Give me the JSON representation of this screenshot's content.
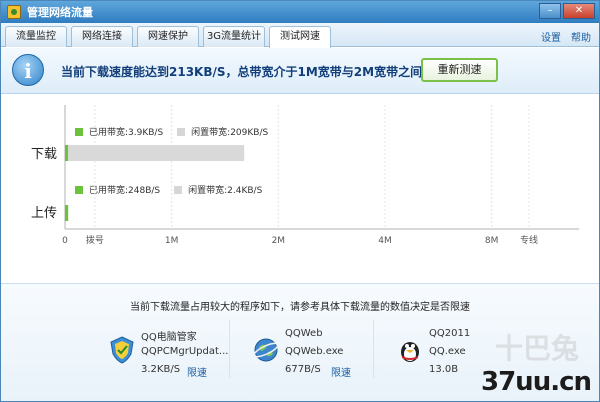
{
  "window": {
    "title": "管理网络流量"
  },
  "tabs": [
    {
      "label": "流量监控"
    },
    {
      "label": "网络连接"
    },
    {
      "label": "网速保护"
    },
    {
      "label": "3G流量统计"
    },
    {
      "label": "测试网速"
    }
  ],
  "toplinks": {
    "settings": "设置",
    "help": "帮助"
  },
  "banner": {
    "message": "当前下载速度能达到213KB/S，总带宽介于1M宽带与2M宽带之间",
    "retest_button": "重新测速"
  },
  "legend": {
    "download": {
      "used": "已用带宽:3.9KB/S",
      "idle": "闲置带宽:209KB/S"
    },
    "upload": {
      "used": "已用带宽:248B/S",
      "idle": "闲置带宽:2.4KB/S"
    }
  },
  "chart_data": {
    "type": "bar",
    "categories": [
      "下载",
      "上传"
    ],
    "series": [
      {
        "name": "已用带宽",
        "values": [
          0.03,
          0.03
        ]
      },
      {
        "name": "闲置带宽",
        "values": [
          1.65,
          0.0
        ]
      }
    ],
    "tick_labels": [
      "0",
      "拨号",
      "1M",
      "2M",
      "4M",
      "8M",
      "专线"
    ],
    "tick_positions": [
      0,
      0.28,
      1,
      2,
      3,
      4,
      4.35
    ],
    "xlim": [
      0,
      4.65
    ],
    "colors": {
      "used": "#6cc23a",
      "idle": "#d9d9d9"
    },
    "grid": true
  },
  "bottom": {
    "message": "当前下载流量占用较大的程序如下，请参考具体下载流量的数值决定是否限速",
    "processes": [
      {
        "name": "QQ电脑管家",
        "exe": "QQPCMgrUpdat...",
        "speed": "3.2KB/S",
        "limit": "限速",
        "icon": "qq-pcmgr-shield-icon"
      },
      {
        "name": "QQWeb",
        "exe": "QQWeb.exe",
        "speed": "677B/S",
        "limit": "限速",
        "icon": "qqweb-globe-icon"
      },
      {
        "name": "QQ2011",
        "exe": "QQ.exe",
        "speed": "13.0B",
        "limit": "",
        "icon": "qq-penguin-icon"
      }
    ]
  },
  "watermark": {
    "text": "37uu.cn",
    "faint": "十巴兔"
  }
}
